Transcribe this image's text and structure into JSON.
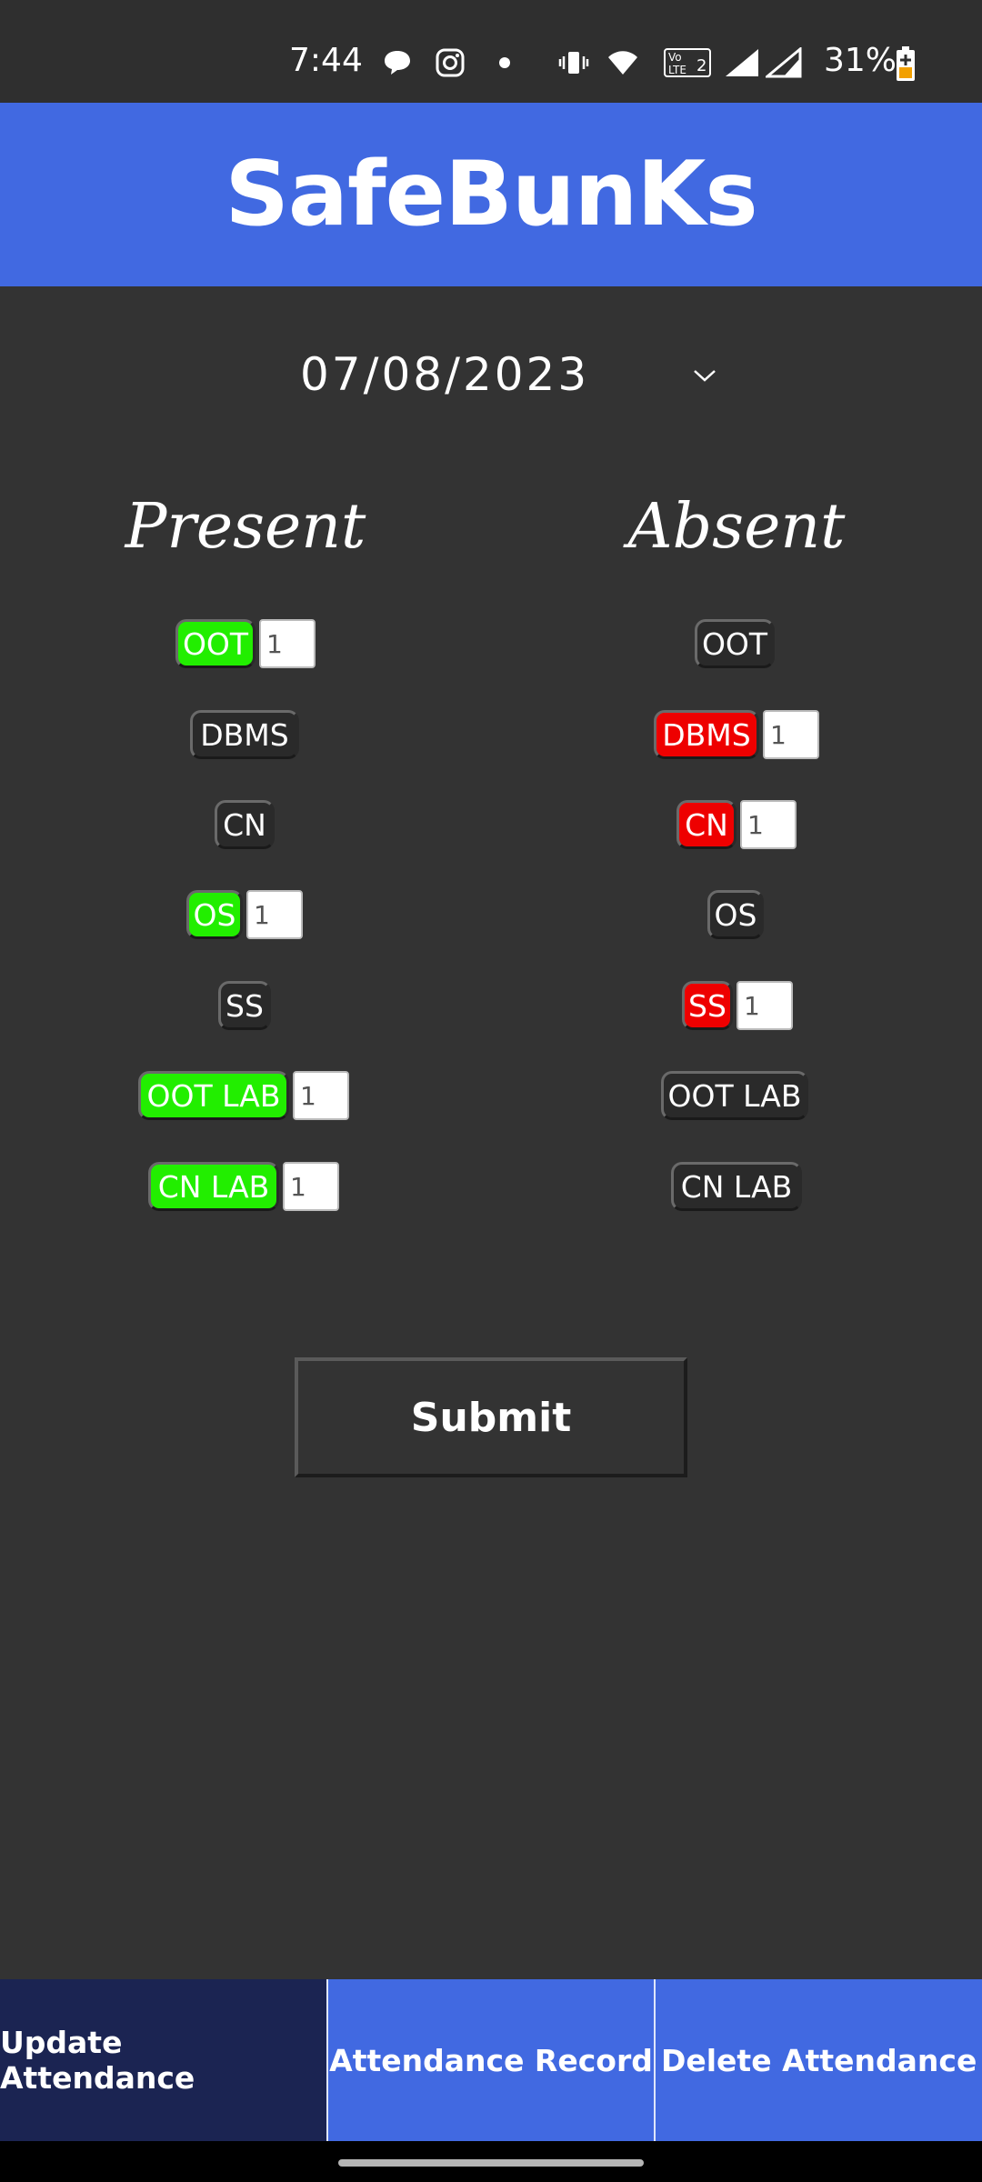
{
  "status_bar": {
    "time": "7:44",
    "battery": "31%",
    "icons": [
      "chat-bubble-icon",
      "instagram-icon",
      "dot-icon",
      "vibrate-icon",
      "wifi-icon",
      "volte-icon",
      "signal-icon",
      "signal-icon",
      "battery-charging-icon"
    ]
  },
  "header": {
    "title": "SafeBunKs"
  },
  "date_picker": {
    "value": "07/08/2023"
  },
  "present": {
    "title": "Present",
    "items": [
      {
        "label": "OOT",
        "selected": true,
        "count": "1"
      },
      {
        "label": "DBMS",
        "selected": false
      },
      {
        "label": "CN",
        "selected": false
      },
      {
        "label": "OS",
        "selected": true,
        "count": "1"
      },
      {
        "label": "SS",
        "selected": false
      },
      {
        "label": "OOT LAB",
        "selected": true,
        "count": "1"
      },
      {
        "label": "CN LAB",
        "selected": true,
        "count": "1"
      }
    ]
  },
  "absent": {
    "title": "Absent",
    "items": [
      {
        "label": "OOT",
        "selected": false
      },
      {
        "label": "DBMS",
        "selected": true,
        "count": "1"
      },
      {
        "label": "CN",
        "selected": true,
        "count": "1"
      },
      {
        "label": "OS",
        "selected": false
      },
      {
        "label": "SS",
        "selected": true,
        "count": "1"
      },
      {
        "label": "OOT LAB",
        "selected": false
      },
      {
        "label": "CN LAB",
        "selected": false
      }
    ]
  },
  "submit_label": "Submit",
  "bottom_nav": [
    {
      "label": "Update Attendance",
      "active": true
    },
    {
      "label": "Attendance Record",
      "active": false
    },
    {
      "label": "Delete Attendance",
      "active": false
    }
  ],
  "colors": {
    "background": "#333333",
    "header": "#4169e1",
    "present": "#22ee00",
    "absent": "#ee0000",
    "nav_active": "#1b2452"
  }
}
